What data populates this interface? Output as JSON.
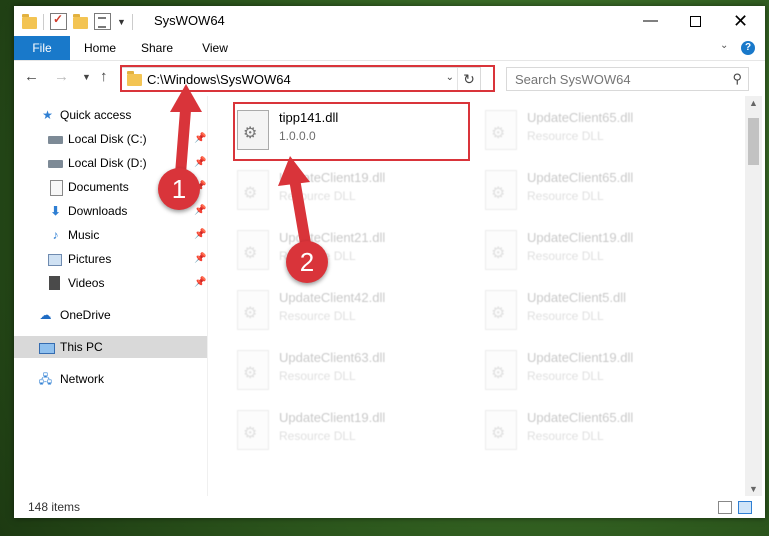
{
  "window": {
    "title": "SysWOW64",
    "minimize_glyph": "—",
    "close_glyph": "✕"
  },
  "ribbon": {
    "tabs": [
      "File",
      "Home",
      "Share",
      "View"
    ]
  },
  "nav": {
    "address_path": "C:\\Windows\\SysWOW64",
    "search_placeholder": "Search SysWOW64"
  },
  "sidebar": {
    "items": [
      {
        "label": "Quick access",
        "icon": "star-icon",
        "pinned": false
      },
      {
        "label": "Local Disk (C:)",
        "icon": "disk-icon",
        "pinned": true
      },
      {
        "label": "Local Disk (D:)",
        "icon": "disk-icon",
        "pinned": true
      },
      {
        "label": "Documents",
        "icon": "documents-icon",
        "pinned": true
      },
      {
        "label": "Downloads",
        "icon": "downloads-icon",
        "pinned": true
      },
      {
        "label": "Music",
        "icon": "music-icon",
        "pinned": true
      },
      {
        "label": "Pictures",
        "icon": "pictures-icon",
        "pinned": true
      },
      {
        "label": "Videos",
        "icon": "videos-icon",
        "pinned": true
      },
      {
        "label": "OneDrive",
        "icon": "onedrive-icon",
        "pinned": false
      },
      {
        "label": "This PC",
        "icon": "this-pc-icon",
        "pinned": false,
        "selected": true
      },
      {
        "label": "Network",
        "icon": "network-icon",
        "pinned": false
      }
    ]
  },
  "files": {
    "items": [
      {
        "name": "tipp141.dll",
        "type": "1.0.0.0",
        "highlighted": true
      },
      {
        "name": "UpdateClient65.dll",
        "type": "Resource DLL"
      },
      {
        "name": "UpdateClient19.dll",
        "type": "Resource DLL"
      },
      {
        "name": "UpdateClient65.dll",
        "type": "Resource DLL"
      },
      {
        "name": "UpdateClient21.dll",
        "type": "Resource DLL"
      },
      {
        "name": "UpdateClient19.dll",
        "type": "Resource DLL"
      },
      {
        "name": "UpdateClient42.dll",
        "type": "Resource DLL"
      },
      {
        "name": "UpdateClient5.dll",
        "type": "Resource DLL"
      },
      {
        "name": "UpdateClient63.dll",
        "type": "Resource DLL"
      },
      {
        "name": "UpdateClient19.dll",
        "type": "Resource DLL"
      },
      {
        "name": "UpdateClient19.dll",
        "type": "Resource DLL"
      },
      {
        "name": "UpdateClient65.dll",
        "type": "Resource DLL"
      }
    ]
  },
  "status": {
    "item_count": "148 items"
  },
  "annotations": {
    "step1": "1",
    "step2": "2",
    "color": "#d9343a"
  }
}
